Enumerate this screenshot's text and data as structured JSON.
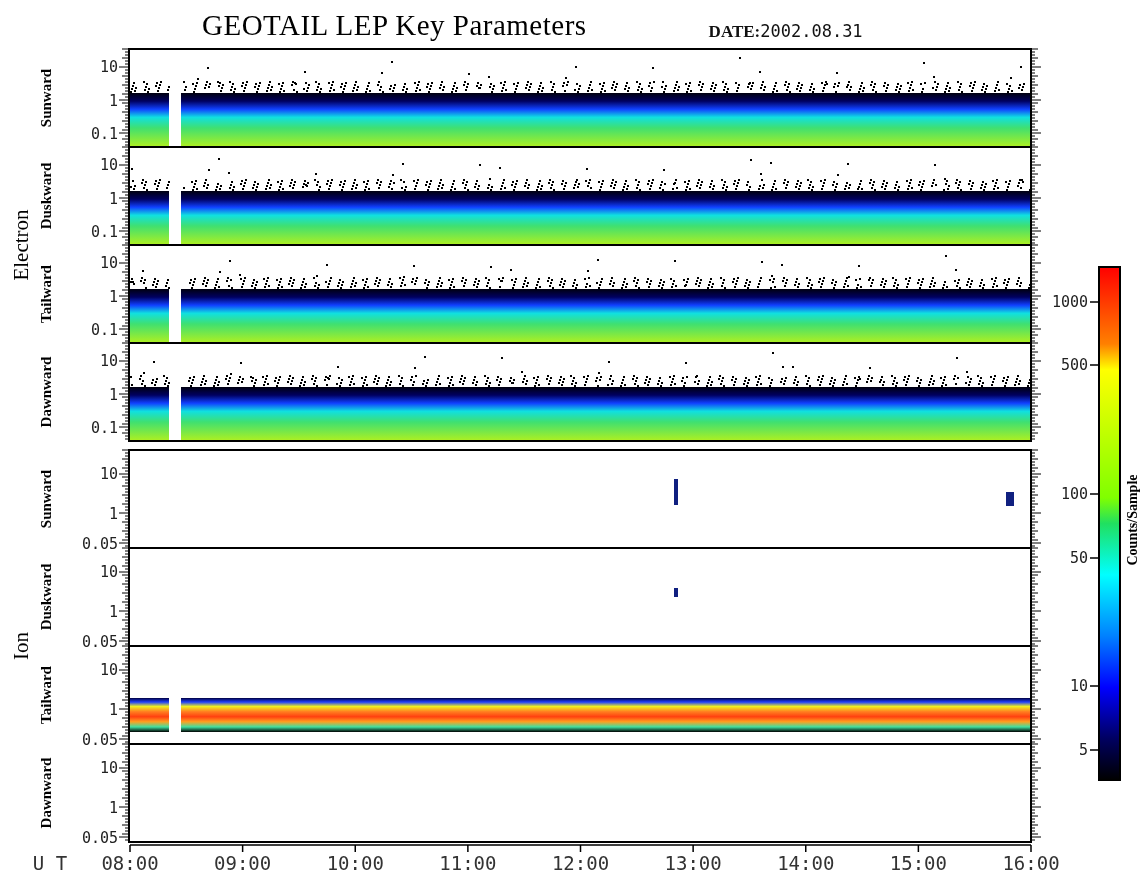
{
  "title": "GEOTAIL LEP Key Parameters",
  "date": "**DATE:**2002.08.31",
  "groups": [
    {
      "name": "Electron",
      "kind": "electron",
      "panels": [
        {
          "name": "Sunward",
          "kind": "electron-band",
          "yticks": [
            "10",
            "1",
            "0.1"
          ]
        },
        {
          "name": "Duskward",
          "kind": "electron-band",
          "yticks": [
            "10",
            "1",
            "0.1"
          ]
        },
        {
          "name": "Tailward",
          "kind": "electron-band",
          "yticks": [
            "10",
            "1",
            "0.1"
          ]
        },
        {
          "name": "Dawnward",
          "kind": "electron-band",
          "yticks": [
            "10",
            "1",
            "0.1"
          ]
        }
      ]
    },
    {
      "name": "Ion",
      "kind": "ion",
      "panels": [
        {
          "name": "Sunward",
          "kind": "ion-sparse",
          "yticks": [
            "10",
            "1",
            "0.05"
          ]
        },
        {
          "name": "Duskward",
          "kind": "ion-speck",
          "yticks": [
            "10",
            "1",
            "0.05"
          ]
        },
        {
          "name": "Tailward",
          "kind": "ion-band",
          "yticks": [
            "10",
            "1",
            "0.05"
          ]
        },
        {
          "name": "Dawnward",
          "kind": "empty",
          "yticks": [
            "10",
            "1",
            "0.05"
          ]
        }
      ]
    }
  ],
  "x_axis": {
    "label": "U T",
    "ticks": [
      "08:00",
      "09:00",
      "10:00",
      "11:00",
      "12:00",
      "13:00",
      "14:00",
      "15:00",
      "16:00"
    ]
  },
  "colorbar": {
    "label": "Counts/Sample",
    "ticks": [
      "1000",
      "500",
      "100",
      "50",
      "10",
      "5"
    ]
  }
}
